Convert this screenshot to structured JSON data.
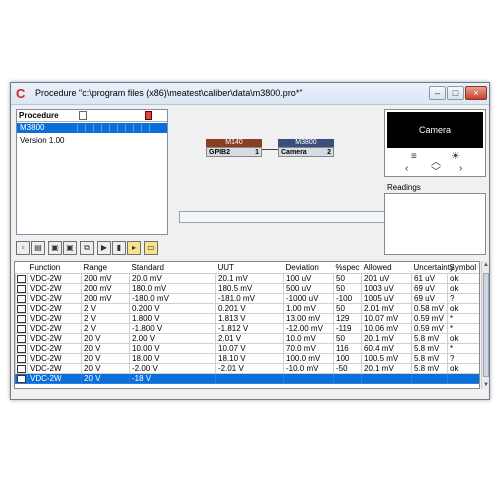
{
  "window": {
    "title": "Procedure \"c:\\program files (x86)\\meatest\\caliber\\data\\m3800.pro*\"",
    "app_icon": "C",
    "minimize_glyph": "–",
    "maximize_glyph": "□",
    "close_glyph": "×"
  },
  "procedure_panel": {
    "header": "Procedure",
    "items": [
      "M3800",
      "Version 1.00"
    ]
  },
  "toolbar": {
    "buttons": [
      "new-icon",
      "open-icon",
      "save-icon",
      "save-as-icon",
      "copy-icon",
      "play-icon",
      "step-icon",
      "export-icon",
      "folder-icon"
    ]
  },
  "diagram": {
    "nodes": [
      {
        "title": "M140",
        "port": "GPIB2",
        "number": "1"
      },
      {
        "title": "M3800",
        "port": "Camera",
        "number": "2"
      }
    ]
  },
  "camera": {
    "label": "Camera",
    "readings_label": "Readings"
  },
  "table": {
    "columns": [
      "Function",
      "Range",
      "Standard",
      "UUT",
      "Deviation",
      "%spec",
      "Allowed",
      "Uncertainty",
      "Symbol"
    ],
    "rows": [
      [
        "VDC-2W",
        "200 mV",
        "20.0 mV",
        "20.1 mV",
        "100 uV",
        "50",
        "201 uV",
        "61 uV",
        "ok"
      ],
      [
        "VDC-2W",
        "200 mV",
        "180.0 mV",
        "180.5 mV",
        "500 uV",
        "50",
        "1003 uV",
        "69 uV",
        "ok"
      ],
      [
        "VDC-2W",
        "200 mV",
        "-180.0 mV",
        "-181.0 mV",
        "-1000 uV",
        "-100",
        "1005 uV",
        "69 uV",
        "?"
      ],
      [
        "VDC-2W",
        "2 V",
        "0.200 V",
        "0.201 V",
        "1.00 mV",
        "50",
        "2.01 mV",
        "0.58 mV",
        "ok"
      ],
      [
        "VDC-2W",
        "2 V",
        "1.800 V",
        "1.813 V",
        "13.00 mV",
        "129",
        "10.07 mV",
        "0.59 mV",
        "*"
      ],
      [
        "VDC-2W",
        "2 V",
        "-1.800 V",
        "-1.812 V",
        "-12.00 mV",
        "-119",
        "10.06 mV",
        "0.59 mV",
        "*"
      ],
      [
        "VDC-2W",
        "20 V",
        "2.00 V",
        "2.01 V",
        "10.0 mV",
        "50",
        "20.1 mV",
        "5.8 mV",
        "ok"
      ],
      [
        "VDC-2W",
        "20 V",
        "10.00 V",
        "10.07 V",
        "70.0 mV",
        "116",
        "60.4 mV",
        "5.8 mV",
        "*"
      ],
      [
        "VDC-2W",
        "20 V",
        "18.00 V",
        "18.10 V",
        "100.0 mV",
        "100",
        "100.5 mV",
        "5.8 mV",
        "?"
      ],
      [
        "VDC-2W",
        "20 V",
        "-2.00 V",
        "-2.01 V",
        "-10.0 mV",
        "-50",
        "20.1 mV",
        "5.8 mV",
        "ok"
      ],
      [
        "VDC-2W",
        "20 V",
        "-18 V",
        "",
        "",
        "",
        "",
        "",
        ""
      ]
    ],
    "selected_row": 10
  }
}
